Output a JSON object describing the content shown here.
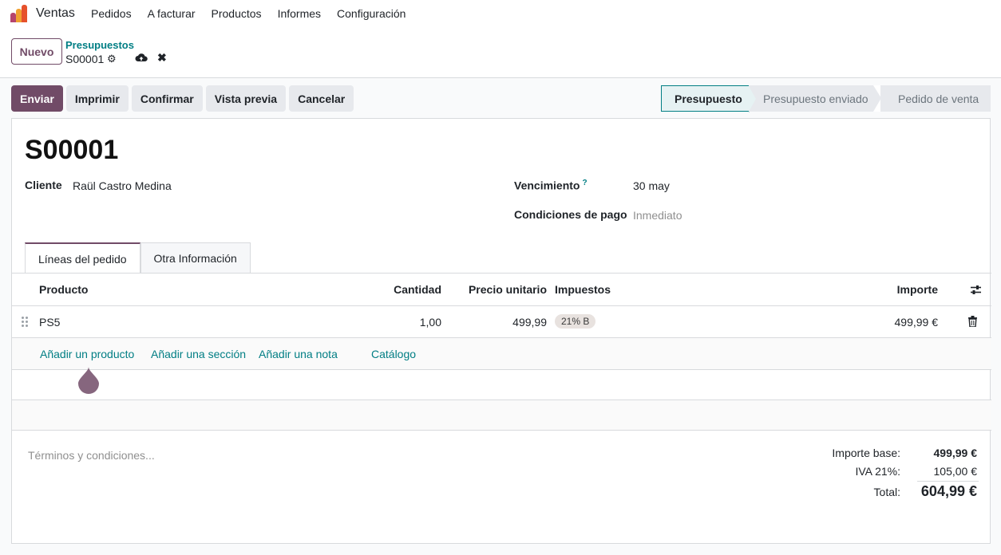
{
  "app": {
    "name": "Ventas"
  },
  "menu": [
    "Pedidos",
    "A facturar",
    "Productos",
    "Informes",
    "Configuración"
  ],
  "control": {
    "new_label": "Nuevo",
    "breadcrumb_parent": "Presupuestos",
    "breadcrumb_current": "S00001"
  },
  "actions": [
    "Enviar",
    "Imprimir",
    "Confirmar",
    "Vista previa",
    "Cancelar"
  ],
  "stages": [
    "Presupuesto",
    "Presupuesto enviado",
    "Pedido de venta"
  ],
  "colors": {
    "brand": "#714b67",
    "link": "#017e84"
  },
  "form": {
    "title": "S00001",
    "customer_label": "Cliente",
    "customer_value": "Raül Castro Medina",
    "due_label": "Vencimiento",
    "due_help": "?",
    "due_value": "30 may",
    "terms_label": "Condiciones de pago",
    "terms_value": "Inmediato"
  },
  "tabs": [
    "Líneas del pedido",
    "Otra Información"
  ],
  "table": {
    "headers": {
      "product": "Producto",
      "qty": "Cantidad",
      "price": "Precio unitario",
      "taxes": "Impuestos",
      "amount": "Importe"
    },
    "rows": [
      {
        "product": "PS5",
        "qty": "1,00",
        "price": "499,99",
        "tax": "21% B",
        "amount": "499,99 €"
      }
    ],
    "add_links": [
      "Añadir un producto",
      "Añadir una sección",
      "Añadir una nota",
      "Catálogo"
    ]
  },
  "footer": {
    "terms_placeholder": "Términos y condiciones...",
    "base_label": "Importe base:",
    "base_value": "499,99 €",
    "tax_label": "IVA 21%:",
    "tax_value": "105,00 €",
    "total_label": "Total:",
    "total_value": "604,99 €"
  }
}
